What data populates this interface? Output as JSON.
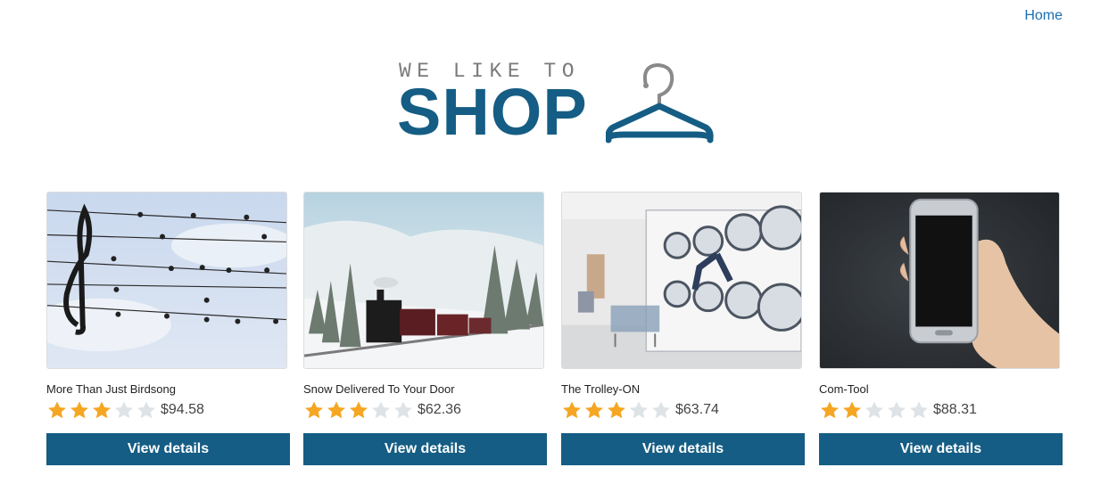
{
  "nav": {
    "home_label": "Home"
  },
  "logo": {
    "tagline": "WE LIKE TO",
    "word": "SHOP",
    "icon": "hanger-icon"
  },
  "colors": {
    "brand": "#155d84",
    "star_on": "#f5a623",
    "star_off": "#dde3e6",
    "link": "#1a6fb5"
  },
  "products": [
    {
      "title": "More Than Just Birdsong",
      "rating": 3,
      "max_rating": 5,
      "price": "$94.58",
      "button": "View details",
      "image": "birds-on-music-staff"
    },
    {
      "title": "Snow Delivered To Your Door",
      "rating": 3,
      "max_rating": 5,
      "price": "$62.36",
      "button": "View details",
      "image": "steam-train-in-snow"
    },
    {
      "title": "The Trolley-ON",
      "rating": 3,
      "max_rating": 5,
      "price": "$63.74",
      "button": "View details",
      "image": "person-in-laundromat-dryer"
    },
    {
      "title": "Com-Tool",
      "rating": 2,
      "max_rating": 5,
      "price": "$88.31",
      "button": "View details",
      "image": "hand-holding-smartphone"
    }
  ]
}
